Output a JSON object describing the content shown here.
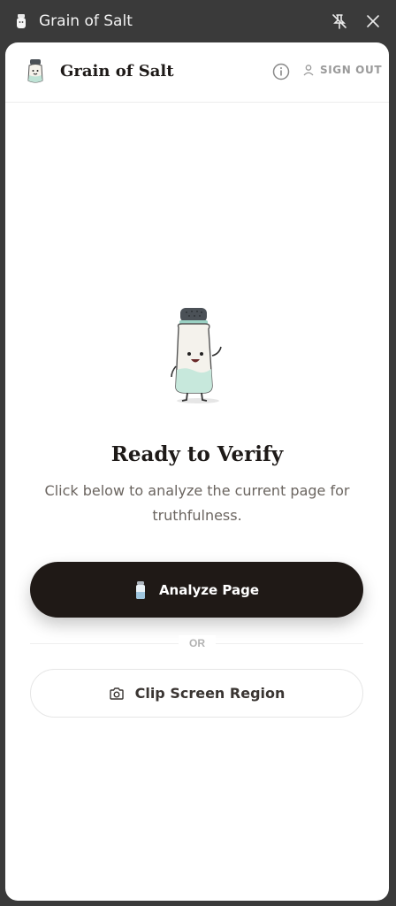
{
  "window": {
    "title": "Grain of Salt",
    "icon": "salt-shaker-icon",
    "buttons": [
      "pin-icon",
      "close-icon"
    ]
  },
  "header": {
    "brand_name": "Grain of Salt",
    "info_icon": "info-icon",
    "sign_out_label": "SIGN OUT",
    "sign_out_icon": "user-icon"
  },
  "main": {
    "heading": "Ready to Verify",
    "subtext": "Click below to analyze the current page for truthfulness.",
    "analyze_button_label": "Analyze Page",
    "divider_label": "OR",
    "clip_button_label": "Clip Screen Region",
    "clip_icon": "camera-icon"
  },
  "colors": {
    "primary_button": "#1f1916",
    "heading": "#1e1a18",
    "muted_text": "#6b6560",
    "window_chrome": "#3a3a3a",
    "mascot_accent": "#bfe3d6"
  }
}
